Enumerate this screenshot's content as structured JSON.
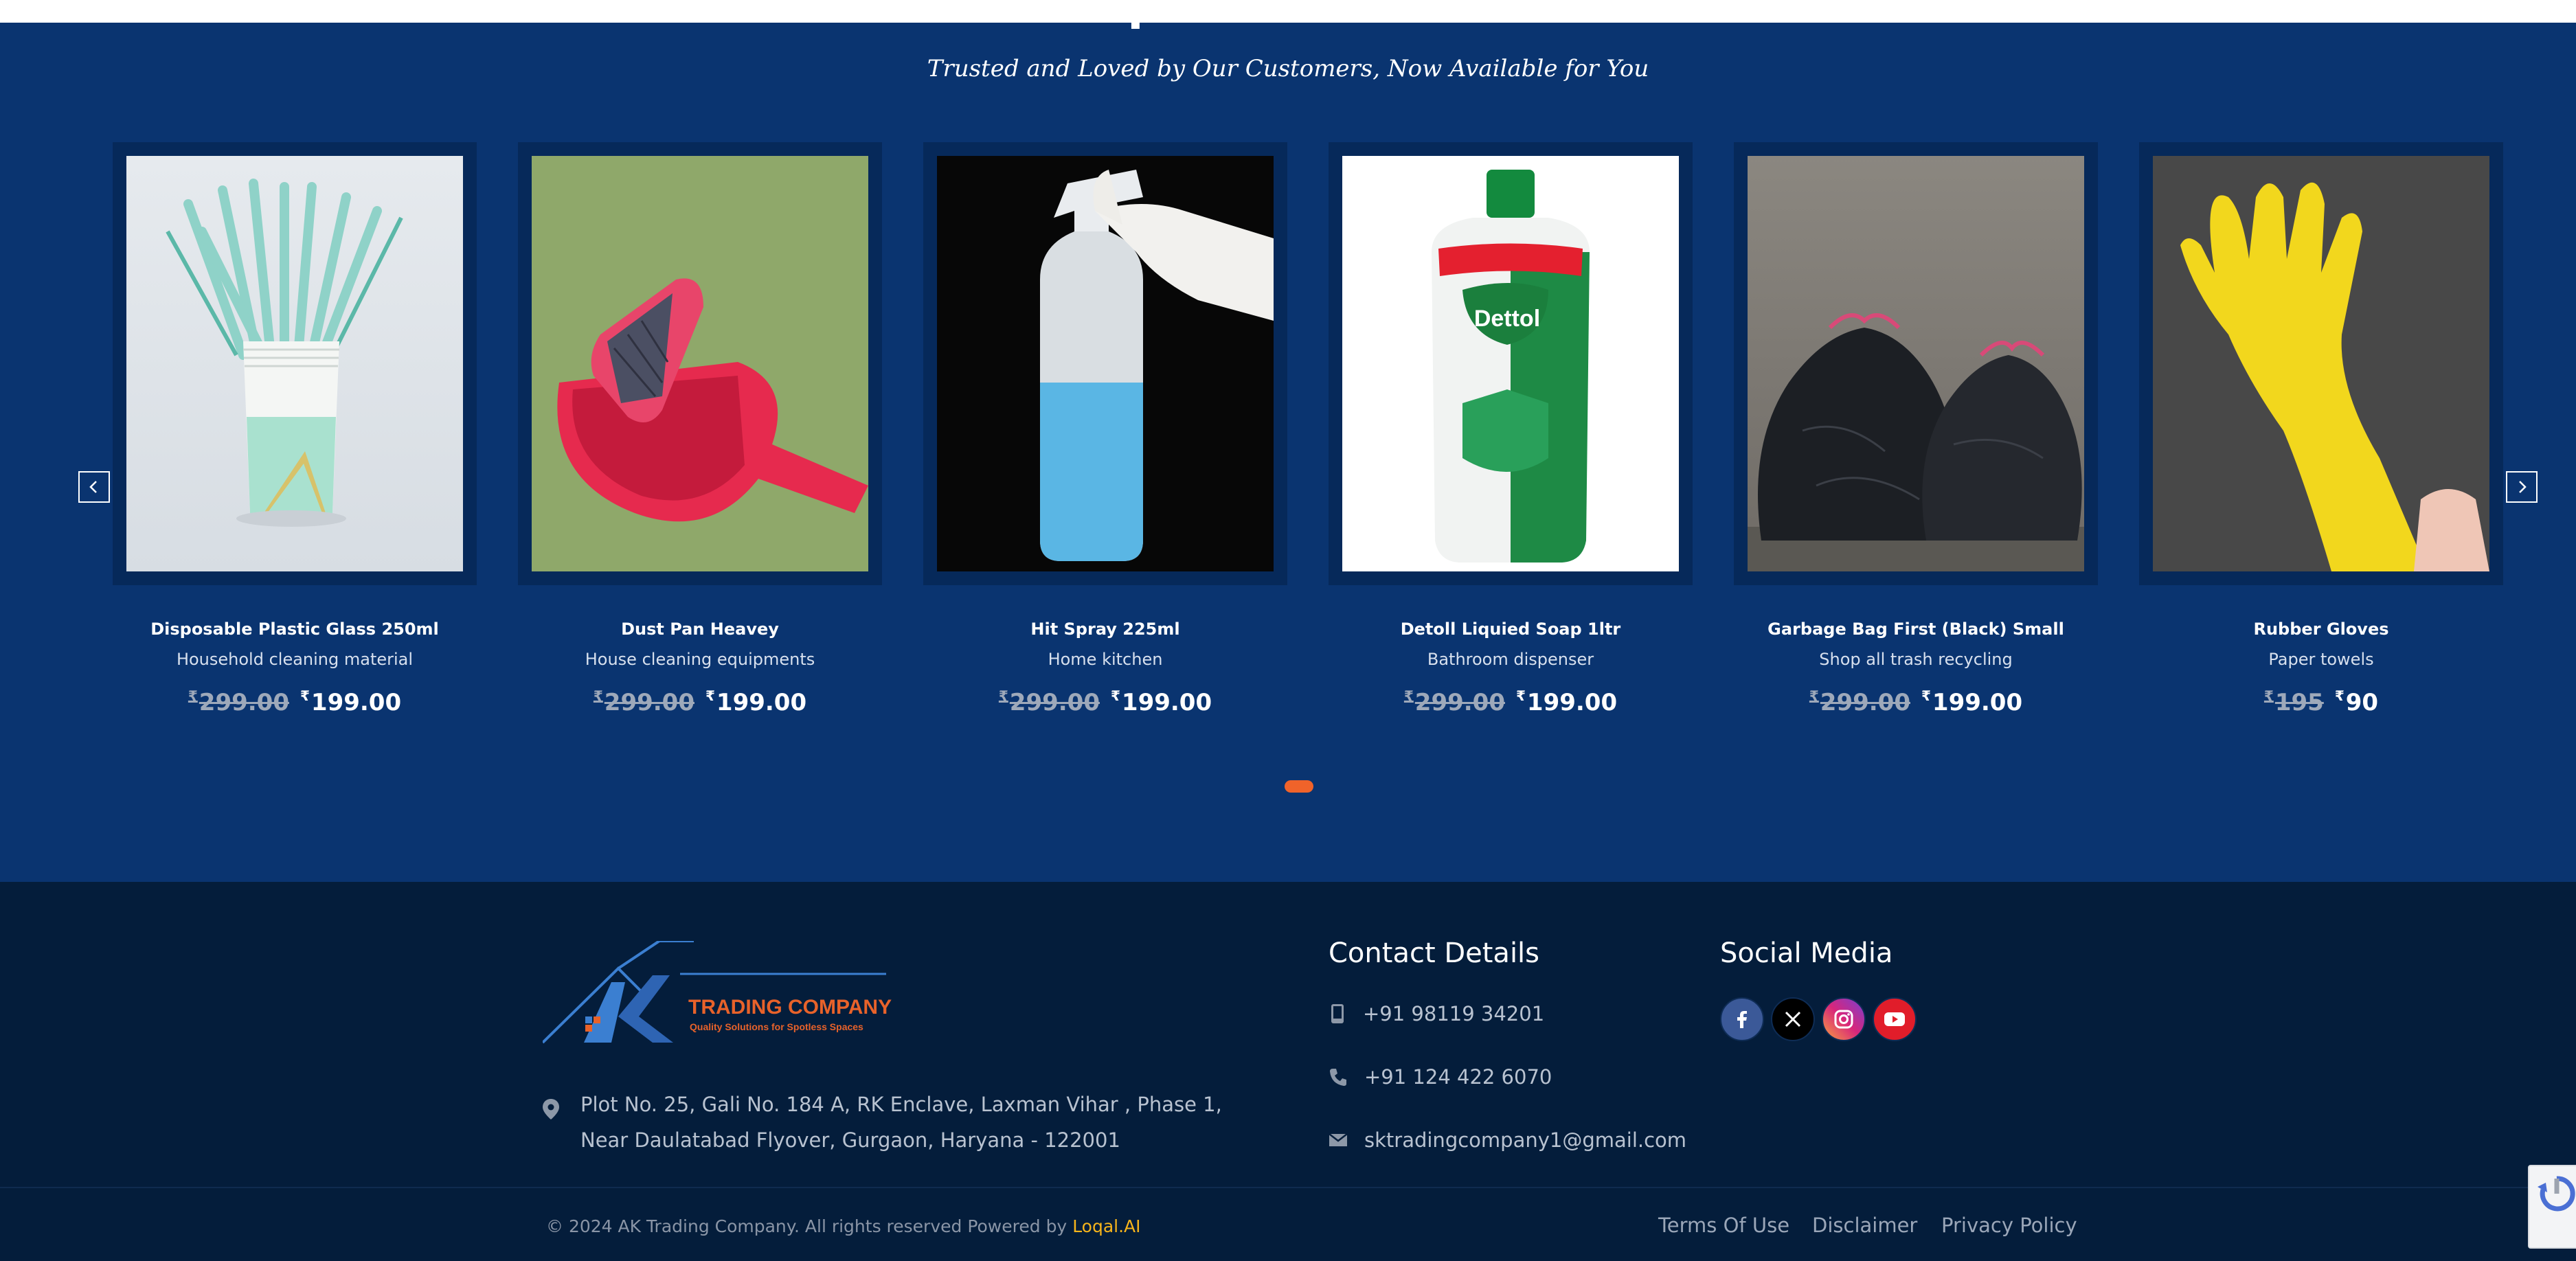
{
  "section": {
    "title": "Popular Products",
    "subtitle": "Trusted and Loved by Our Customers, Now Available for You"
  },
  "currency": "₹",
  "products": [
    {
      "name": "Disposable Plastic Glass 250ml",
      "desc": "Household cleaning material",
      "old_price": "299.00",
      "new_price": "199.00"
    },
    {
      "name": "Dust Pan Heavey",
      "desc": "House cleaning equipments",
      "old_price": "299.00",
      "new_price": "199.00"
    },
    {
      "name": "Hit Spray 225ml",
      "desc": "Home kitchen",
      "old_price": "299.00",
      "new_price": "199.00"
    },
    {
      "name": "Detoll Liquied Soap 1ltr",
      "desc": "Bathroom dispenser",
      "old_price": "299.00",
      "new_price": "199.00"
    },
    {
      "name": "Garbage Bag First (Black) Small",
      "desc": "Shop all trash recycling",
      "old_price": "299.00",
      "new_price": "199.00"
    },
    {
      "name": "Rubber Gloves",
      "desc": "Paper towels",
      "old_price": "195",
      "new_price": "90"
    }
  ],
  "logo": {
    "name": "TRADING COMPANY",
    "tagline": "Quality Solutions for Spotless Spaces"
  },
  "address": {
    "line1": "Plot No. 25, Gali No. 184 A, RK Enclave, Laxman Vihar , Phase 1,",
    "line2": "Near Daulatabad Flyover, Gurgaon, Haryana - 122001"
  },
  "contact": {
    "title": "Contact Details",
    "mobile": "+91 98119 34201",
    "phone": "+91 124 422 6070",
    "email": "sktradingcompany1@gmail.com"
  },
  "social": {
    "title": "Social Media"
  },
  "footer": {
    "copyright": "© 2024 AK Trading Company. All rights reserved Powered by",
    "powered_by": "Loqal.AI",
    "links": [
      "Terms Of Use",
      "Disclaimer",
      "Privacy Policy"
    ]
  },
  "colors": {
    "section_bg": "#0a3470",
    "footer_bg": "#041d3b",
    "accent": "#f0632a",
    "powered_by": "#f7b41b"
  },
  "icons": {
    "prev": "chevron-left-icon",
    "next": "chevron-right-icon",
    "address": "map-pin-icon",
    "mobile": "mobile-phone-icon",
    "phone": "phone-icon",
    "email": "envelope-icon",
    "social": [
      "facebook-icon",
      "x-twitter-icon",
      "instagram-icon",
      "youtube-icon"
    ]
  }
}
